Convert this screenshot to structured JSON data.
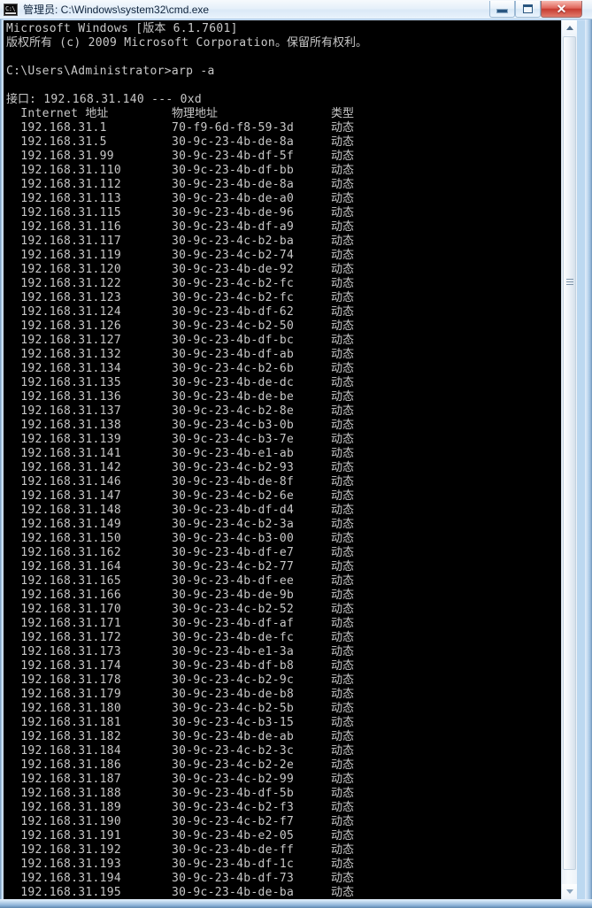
{
  "window": {
    "title": "管理员: C:\\Windows\\system32\\cmd.exe",
    "icon": "cmd-console-icon",
    "icon_glyph": "C:\\",
    "buttons": {
      "minimize": "minimize-button",
      "maximize": "maximize-button",
      "close_label": "✕"
    },
    "colors": {
      "console_bg": "#000000",
      "console_fg": "#c8c8c8",
      "titlebar": "#e6f0fa",
      "close_button": "#c63c31",
      "frame": "#6f93b8"
    }
  },
  "console": {
    "banner": [
      "Microsoft Windows [版本 6.1.7601]",
      "版权所有 (c) 2009 Microsoft Corporation。保留所有权利。"
    ],
    "blank_1": "",
    "prompt": "C:\\Users\\Administrator>",
    "command": "arp -a",
    "blank_2": "",
    "interface_line": "接口: 192.168.31.140 --- 0xd",
    "headers": {
      "internet_address": "  Internet 地址",
      "physical_address": "物理地址",
      "type": "类型"
    },
    "entry_type": "动态",
    "entries": [
      {
        "ip": "192.168.31.1",
        "mac": "70-f9-6d-f8-59-3d",
        "type": "动态"
      },
      {
        "ip": "192.168.31.5",
        "mac": "30-9c-23-4b-de-8a",
        "type": "动态"
      },
      {
        "ip": "192.168.31.99",
        "mac": "30-9c-23-4b-df-5f",
        "type": "动态"
      },
      {
        "ip": "192.168.31.110",
        "mac": "30-9c-23-4b-df-bb",
        "type": "动态"
      },
      {
        "ip": "192.168.31.112",
        "mac": "30-9c-23-4b-de-8a",
        "type": "动态"
      },
      {
        "ip": "192.168.31.113",
        "mac": "30-9c-23-4b-de-a0",
        "type": "动态"
      },
      {
        "ip": "192.168.31.115",
        "mac": "30-9c-23-4b-de-96",
        "type": "动态"
      },
      {
        "ip": "192.168.31.116",
        "mac": "30-9c-23-4b-df-a9",
        "type": "动态"
      },
      {
        "ip": "192.168.31.117",
        "mac": "30-9c-23-4c-b2-ba",
        "type": "动态"
      },
      {
        "ip": "192.168.31.119",
        "mac": "30-9c-23-4c-b2-74",
        "type": "动态"
      },
      {
        "ip": "192.168.31.120",
        "mac": "30-9c-23-4b-de-92",
        "type": "动态"
      },
      {
        "ip": "192.168.31.122",
        "mac": "30-9c-23-4c-b2-fc",
        "type": "动态"
      },
      {
        "ip": "192.168.31.123",
        "mac": "30-9c-23-4c-b2-fc",
        "type": "动态"
      },
      {
        "ip": "192.168.31.124",
        "mac": "30-9c-23-4b-df-62",
        "type": "动态"
      },
      {
        "ip": "192.168.31.126",
        "mac": "30-9c-23-4c-b2-50",
        "type": "动态"
      },
      {
        "ip": "192.168.31.127",
        "mac": "30-9c-23-4b-df-bc",
        "type": "动态"
      },
      {
        "ip": "192.168.31.132",
        "mac": "30-9c-23-4b-df-ab",
        "type": "动态"
      },
      {
        "ip": "192.168.31.134",
        "mac": "30-9c-23-4c-b2-6b",
        "type": "动态"
      },
      {
        "ip": "192.168.31.135",
        "mac": "30-9c-23-4b-de-dc",
        "type": "动态"
      },
      {
        "ip": "192.168.31.136",
        "mac": "30-9c-23-4b-de-be",
        "type": "动态"
      },
      {
        "ip": "192.168.31.137",
        "mac": "30-9c-23-4c-b2-8e",
        "type": "动态"
      },
      {
        "ip": "192.168.31.138",
        "mac": "30-9c-23-4c-b3-0b",
        "type": "动态"
      },
      {
        "ip": "192.168.31.139",
        "mac": "30-9c-23-4c-b3-7e",
        "type": "动态"
      },
      {
        "ip": "192.168.31.141",
        "mac": "30-9c-23-4b-e1-ab",
        "type": "动态"
      },
      {
        "ip": "192.168.31.142",
        "mac": "30-9c-23-4c-b2-93",
        "type": "动态"
      },
      {
        "ip": "192.168.31.146",
        "mac": "30-9c-23-4b-de-8f",
        "type": "动态"
      },
      {
        "ip": "192.168.31.147",
        "mac": "30-9c-23-4c-b2-6e",
        "type": "动态"
      },
      {
        "ip": "192.168.31.148",
        "mac": "30-9c-23-4b-df-d4",
        "type": "动态"
      },
      {
        "ip": "192.168.31.149",
        "mac": "30-9c-23-4c-b2-3a",
        "type": "动态"
      },
      {
        "ip": "192.168.31.150",
        "mac": "30-9c-23-4c-b3-00",
        "type": "动态"
      },
      {
        "ip": "192.168.31.162",
        "mac": "30-9c-23-4b-df-e7",
        "type": "动态"
      },
      {
        "ip": "192.168.31.164",
        "mac": "30-9c-23-4c-b2-77",
        "type": "动态"
      },
      {
        "ip": "192.168.31.165",
        "mac": "30-9c-23-4b-df-ee",
        "type": "动态"
      },
      {
        "ip": "192.168.31.166",
        "mac": "30-9c-23-4b-de-9b",
        "type": "动态"
      },
      {
        "ip": "192.168.31.170",
        "mac": "30-9c-23-4c-b2-52",
        "type": "动态"
      },
      {
        "ip": "192.168.31.171",
        "mac": "30-9c-23-4b-df-af",
        "type": "动态"
      },
      {
        "ip": "192.168.31.172",
        "mac": "30-9c-23-4b-de-fc",
        "type": "动态"
      },
      {
        "ip": "192.168.31.173",
        "mac": "30-9c-23-4b-e1-3a",
        "type": "动态"
      },
      {
        "ip": "192.168.31.174",
        "mac": "30-9c-23-4b-df-b8",
        "type": "动态"
      },
      {
        "ip": "192.168.31.178",
        "mac": "30-9c-23-4c-b2-9c",
        "type": "动态"
      },
      {
        "ip": "192.168.31.179",
        "mac": "30-9c-23-4b-de-b8",
        "type": "动态"
      },
      {
        "ip": "192.168.31.180",
        "mac": "30-9c-23-4c-b2-5b",
        "type": "动态"
      },
      {
        "ip": "192.168.31.181",
        "mac": "30-9c-23-4c-b3-15",
        "type": "动态"
      },
      {
        "ip": "192.168.31.182",
        "mac": "30-9c-23-4b-de-ab",
        "type": "动态"
      },
      {
        "ip": "192.168.31.184",
        "mac": "30-9c-23-4c-b2-3c",
        "type": "动态"
      },
      {
        "ip": "192.168.31.186",
        "mac": "30-9c-23-4c-b2-2e",
        "type": "动态"
      },
      {
        "ip": "192.168.31.187",
        "mac": "30-9c-23-4c-b2-99",
        "type": "动态"
      },
      {
        "ip": "192.168.31.188",
        "mac": "30-9c-23-4b-df-5b",
        "type": "动态"
      },
      {
        "ip": "192.168.31.189",
        "mac": "30-9c-23-4c-b2-f3",
        "type": "动态"
      },
      {
        "ip": "192.168.31.190",
        "mac": "30-9c-23-4c-b2-f7",
        "type": "动态"
      },
      {
        "ip": "192.168.31.191",
        "mac": "30-9c-23-4b-e2-05",
        "type": "动态"
      },
      {
        "ip": "192.168.31.192",
        "mac": "30-9c-23-4b-de-ff",
        "type": "动态"
      },
      {
        "ip": "192.168.31.193",
        "mac": "30-9c-23-4b-df-1c",
        "type": "动态"
      },
      {
        "ip": "192.168.31.194",
        "mac": "30-9c-23-4b-df-73",
        "type": "动态"
      },
      {
        "ip": "192.168.31.195",
        "mac": "30-9c-23-4b-de-ba",
        "type": "动态"
      }
    ]
  },
  "scrollbar": {
    "up_arrow": "scroll-up-arrow",
    "down_arrow": "scroll-down-arrow",
    "thumb": "scroll-thumb"
  }
}
